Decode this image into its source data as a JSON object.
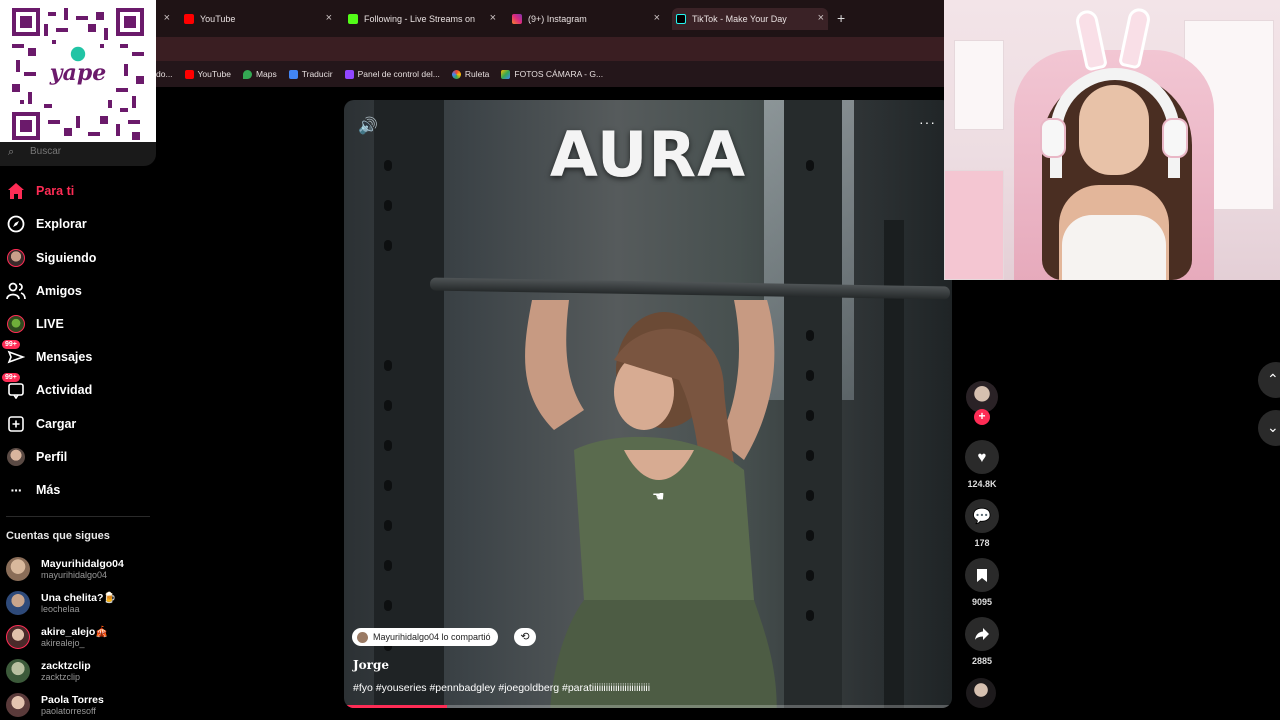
{
  "browser": {
    "tabs": [
      {
        "label": "",
        "active": false
      },
      {
        "label": "YouTube",
        "active": false
      },
      {
        "label": "Following - Live Streams on Kic",
        "active": false
      },
      {
        "label": "(9+) Instagram",
        "active": false
      },
      {
        "label": "TikTok - Make Your Day",
        "active": true
      }
    ],
    "new_tab": "+",
    "close_glyph": "×",
    "bookmarks": [
      {
        "label": "do..."
      },
      {
        "label": "YouTube"
      },
      {
        "label": "Maps"
      },
      {
        "label": "Traducir"
      },
      {
        "label": "Panel de control del..."
      },
      {
        "label": "Ruleta"
      },
      {
        "label": "FOTOS CÁMARA - G..."
      }
    ]
  },
  "qr": {
    "brand": "yape"
  },
  "sidebar": {
    "search_placeholder": "Buscar",
    "nav": [
      {
        "label": "Para ti",
        "icon": "home-icon",
        "active": true
      },
      {
        "label": "Explorar",
        "icon": "compass-icon"
      },
      {
        "label": "Siguiendo",
        "icon": "avatar"
      },
      {
        "label": "Amigos",
        "icon": "friends-icon"
      },
      {
        "label": "LIVE",
        "icon": "live-icon"
      },
      {
        "label": "Mensajes",
        "icon": "messages-icon",
        "badge": "99+"
      },
      {
        "label": "Actividad",
        "icon": "activity-icon",
        "badge": "99+"
      },
      {
        "label": "Cargar",
        "icon": "upload-icon"
      },
      {
        "label": "Perfil",
        "icon": "profile-avatar"
      },
      {
        "label": "Más",
        "icon": "more-icon"
      }
    ],
    "following_title": "Cuentas que sigues",
    "following": [
      {
        "name": "Mayurihidalgo04",
        "handle": "mayurihidalgo04"
      },
      {
        "name": "Una chelita?🍺",
        "handle": "leochelaa"
      },
      {
        "name": "akire_alejo🎪",
        "handle": "akirealejo_"
      },
      {
        "name": "zacktzclip",
        "handle": "zacktzclip"
      },
      {
        "name": "Paola Torres",
        "handle": "paolatorresoff"
      }
    ]
  },
  "video": {
    "overlay_title": "AURA",
    "more": "···",
    "repost_text": "Mayurihidalgo04 lo compartió",
    "author": "Jorge",
    "caption": "#fyo #youseries #pennbadgley #joegoldberg #paratiiiiiiiiiiiiiiiiiiiiiiiii",
    "progress": 0.17
  },
  "actions": {
    "likes": "124.8K",
    "comments": "178",
    "saves": "9095",
    "shares": "2885"
  },
  "colors": {
    "accent": "#fe2c55",
    "sidebar_bg": "#000000",
    "tab_bar": "#1f1315"
  }
}
